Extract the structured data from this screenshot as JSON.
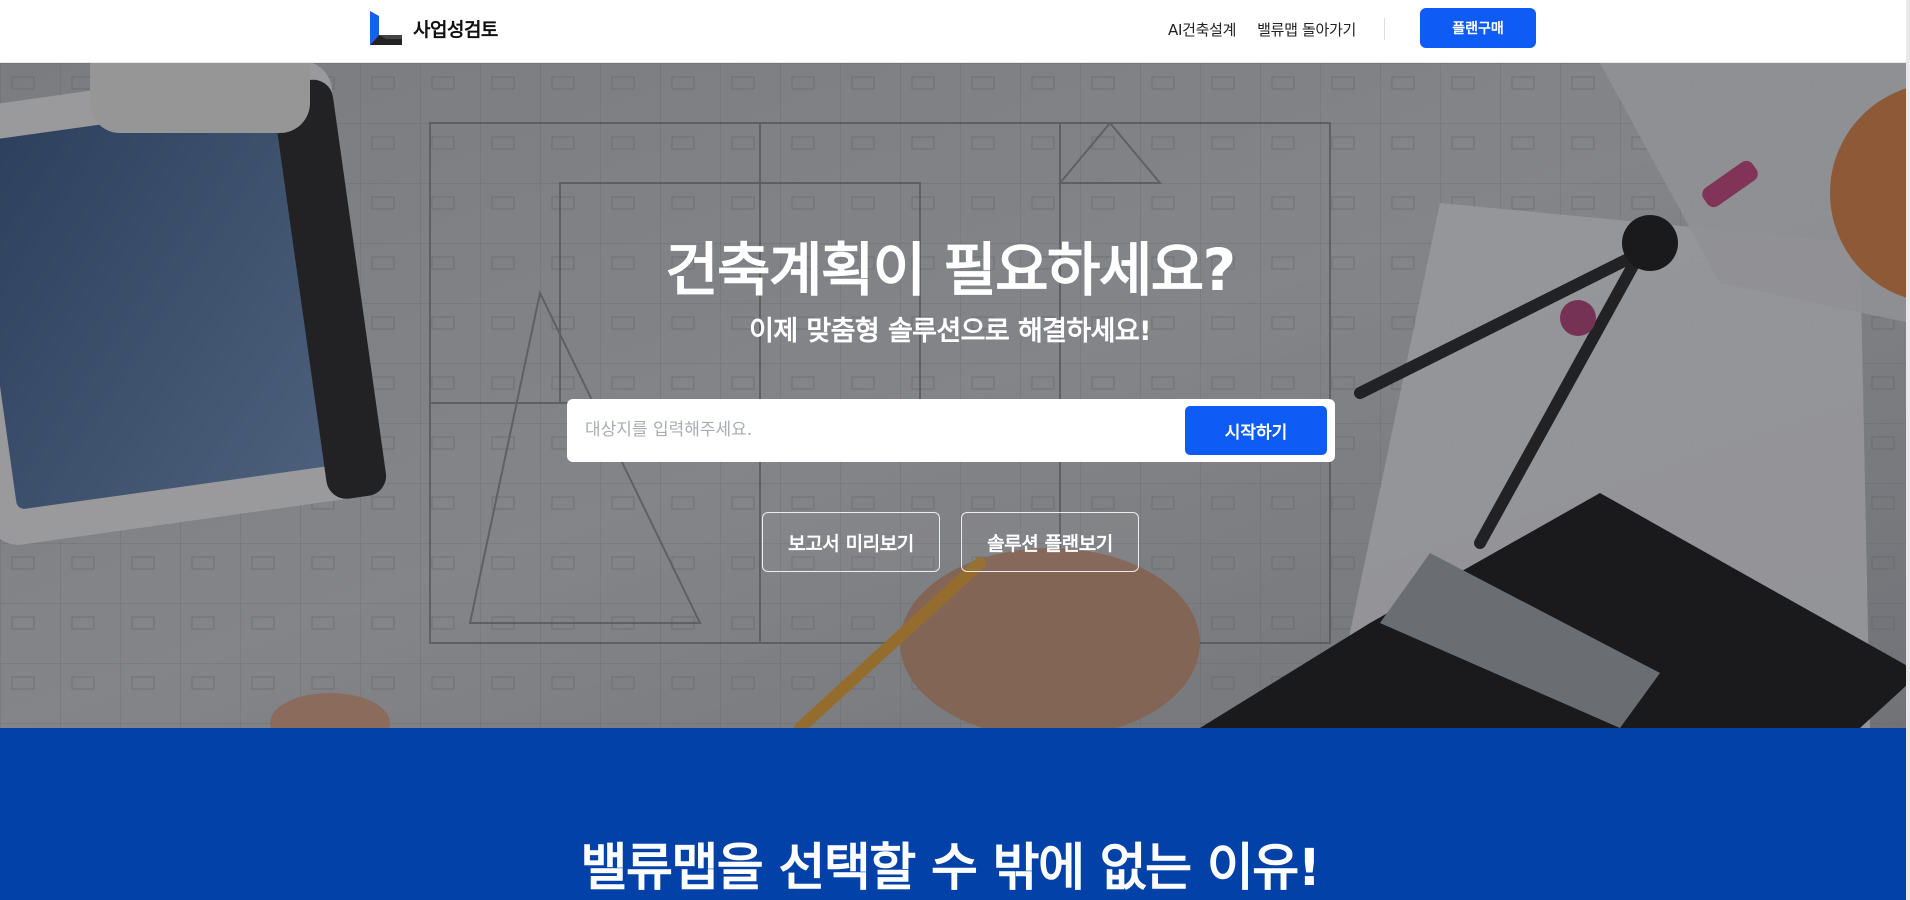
{
  "header": {
    "logo_text": "사업성검토",
    "nav": {
      "ai_design": "AI건축설계",
      "back_to_valuemap": "밸류맵 돌아가기"
    },
    "plan_button": "플랜구매"
  },
  "hero": {
    "title": "건축계획이 필요하세요?",
    "subtitle": "이제 맞춤형 솔루션으로 해결하세요!",
    "search": {
      "placeholder": "대상지를 입력해주세요.",
      "value": "",
      "button": "시작하기"
    },
    "buttons": {
      "report_preview": "보고서 미리보기",
      "solution_plans": "솔루션 플랜보기"
    }
  },
  "why_section": {
    "title": "밸류맵을 선택할 수 밖에 없는 이유!"
  },
  "colors": {
    "accent": "#0e5bf6",
    "section_blue": "#0241a8",
    "logo_blue": "#1560ee",
    "logo_dark": "#222222"
  },
  "icons": {
    "logo": "valuemap-logo-icon"
  }
}
